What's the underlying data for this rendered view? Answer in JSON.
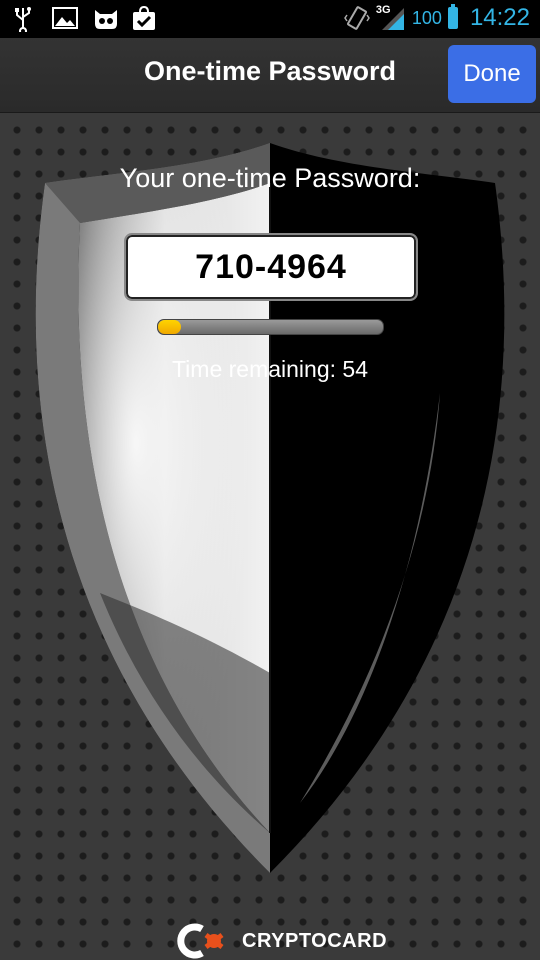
{
  "status_bar": {
    "left_icons": [
      "usb-icon",
      "image-icon",
      "cyanogen-icon",
      "checklist-icon"
    ],
    "right_icons": [
      "vibrate-icon",
      "signal-3g-icon",
      "battery-icon"
    ],
    "network": "3G",
    "battery_level": "100",
    "time": "14:22",
    "accent_color": "#33b5e5"
  },
  "action_bar": {
    "title": "One-time Password",
    "done_label": "Done",
    "done_color": "#3b6ee6"
  },
  "main": {
    "label": "Your one-time Password:",
    "otp": "710-4964",
    "time_remaining_text": "Time remaining: 54",
    "progress_fraction": 0.1,
    "progress_color": "#ffc800"
  },
  "footer": {
    "brand": "CRYPTOCARD"
  }
}
